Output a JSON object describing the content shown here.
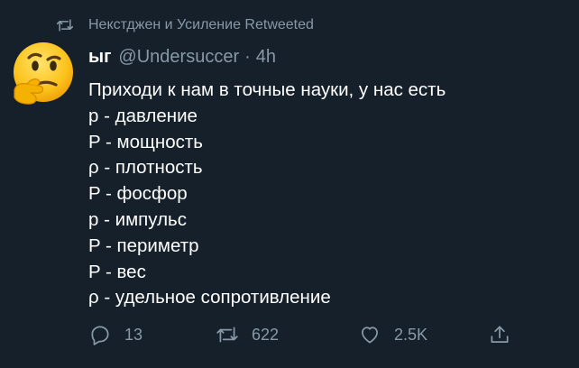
{
  "retweet_context": {
    "icon": "retweet-icon",
    "text": "Некстджен и Усиление Retweeted"
  },
  "tweet": {
    "author_name": "ыг",
    "handle": "@Undersuccer",
    "separator": "·",
    "time": "4h",
    "avatar": "thinking-face-emoji",
    "lines": [
      "Приходи к нам в точные науки, у нас есть",
      "p - давление",
      "P - мощность",
      "ρ - плотность",
      "P - фосфор",
      "p - импульс",
      "P - периметр",
      "P - вес",
      "ρ - удельное сопротивление"
    ]
  },
  "actions": {
    "reply": {
      "icon": "reply-icon",
      "count": "13"
    },
    "retweet": {
      "icon": "retweet-icon",
      "count": "622"
    },
    "like": {
      "icon": "heart-icon",
      "count": "2.5K"
    },
    "share": {
      "icon": "share-icon"
    }
  },
  "colors": {
    "background": "#15202b",
    "text": "#ffffff",
    "secondary": "#8899a6"
  }
}
